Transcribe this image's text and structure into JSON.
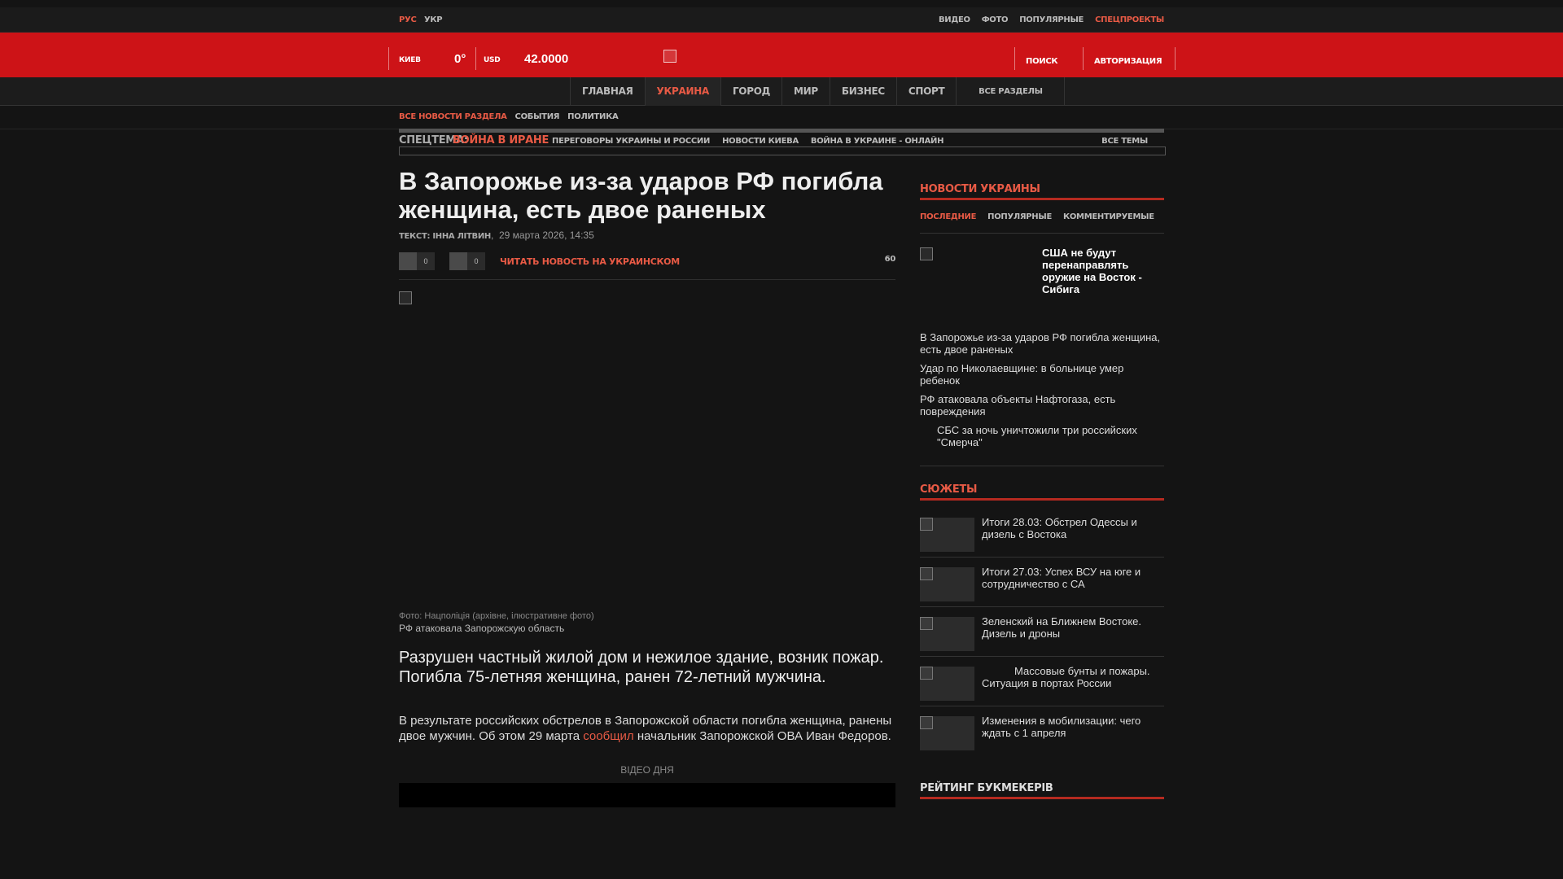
{
  "lang": {
    "ru": "РУС",
    "ua": "УКР"
  },
  "topnav": [
    "ВИДЕО",
    "ФОТО",
    "ПОПУЛЯРНЫЕ",
    "СПЕЦПРОЕКТЫ"
  ],
  "header": {
    "city": "КИЕВ",
    "temp": "0°",
    "currency": "USD",
    "rate": "42.0000",
    "search": "ПОИСК",
    "login": "АВТОРИЗАЦИЯ"
  },
  "mainnav": [
    "ГЛАВНАЯ",
    "УКРАИНА",
    "ГОРОД",
    "МИР",
    "БИЗНЕС",
    "СПОРТ"
  ],
  "mainnav_all": "ВСЕ РАЗДЕЛЫ",
  "subnav": [
    "ВСЕ НОВОСТИ РАЗДЕЛА",
    "СОБЫТИЯ",
    "ПОЛИТИКА"
  ],
  "spectema": {
    "label": "СПЕЦТЕМА:",
    "hot": "ВОЙНА В ИРАНЕ",
    "links": [
      "ПЕРЕГОВОРЫ УКРАИНЫ И РОССИИ",
      "НОВОСТИ КИЕВА",
      "ВОЙНА В УКРАИНЕ - ОНЛАЙН"
    ],
    "all": "ВСЕ ТЕМЫ"
  },
  "article": {
    "title": "В Запорожье из-за ударов РФ погибла женщина, есть двое раненых",
    "author": "ТЕКСТ: ІННА ЛІТВИН",
    "date": "29 марта 2026, 14:35",
    "share_count_1": "0",
    "share_count_2": "0",
    "read_ua": "ЧИТАТЬ НОВОСТЬ НА УКРАИНСКОМ",
    "views": "60",
    "photo_credit": "Фото: Нацполіція (архівне, ілюстративне фото)",
    "photo_caption": "РФ атаковала Запорожскую область",
    "lead": "Разрушен частный жилой дом и нежилое здание, возник пожар. Погибла 75-летняя женщина, ранен 72-летний мужчина.",
    "para_before": "В результате российских обстрелов в Запорожской области погибла женщина, ранены двое мужчин. Об этом 29 марта ",
    "para_link": "сообщил",
    "para_after": " начальник Запорожской ОВА Иван Федоров.",
    "video_label": "ВІДЕО ДНЯ"
  },
  "sidebar": {
    "news_head": "НОВОСТИ УКРАИНЫ",
    "tabs": [
      "ПОСЛЕДНИЕ",
      "ПОПУЛЯРНЫЕ",
      "КОММЕНТИРУЕМЫЕ"
    ],
    "featured": "США не будут перенаправлять оружие на Восток - Сибига",
    "news": [
      "В Запорожье из-за ударов РФ погибла женщина, есть двое раненых",
      "Удар по Николаевщине: в больнице умер ребенок",
      "РФ атаковала объекты Нафтогаза, есть повреждения",
      "СБС за ночь уничтожили три российских \"Смерча\""
    ],
    "stories_head": "СЮЖЕТЫ",
    "stories": [
      "Итоги 28.03: Обстрел Одессы и дизель с Востока",
      "Итоги 27.03: Успех ВСУ на юге и сотрудничество с СА",
      "Зеленский на Ближнем Востоке. Дизель и дроны",
      "Массовые бунты и пожары. Ситуация в портах России",
      "Изменения в мобилизации: чего ждать с 1 апреля"
    ],
    "rating_head": "РЕЙТИНГ БУКМЕКЕРІВ"
  },
  "colors": {
    "brand_red": "#cd1317",
    "accent": "#e85a45",
    "background": "#141414"
  }
}
